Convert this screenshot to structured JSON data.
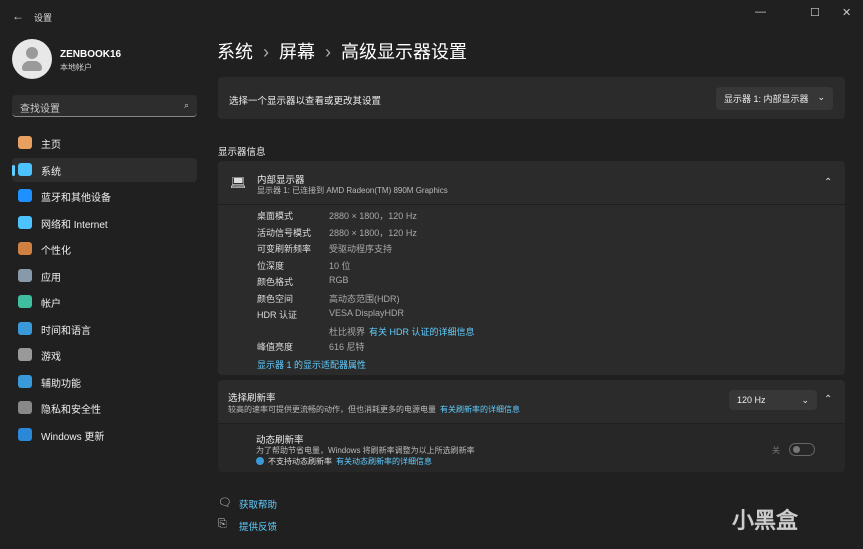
{
  "window": {
    "title": "设置",
    "back": "←",
    "minimize": "—",
    "maximize": "☐",
    "close": "✕"
  },
  "user": {
    "name": "ZENBOOK16",
    "type": "本地帐户"
  },
  "search": {
    "placeholder": "查找设置",
    "icon": "search-icon"
  },
  "sidebar": {
    "items": [
      {
        "label": "主页",
        "color": "#e8a060"
      },
      {
        "label": "系统",
        "color": "#4cc2ff"
      },
      {
        "label": "蓝牙和其他设备",
        "color": "#1e90ff"
      },
      {
        "label": "网络和 Internet",
        "color": "#4cc2ff"
      },
      {
        "label": "个性化",
        "color": "#d08040"
      },
      {
        "label": "应用",
        "color": "#8899aa"
      },
      {
        "label": "帐户",
        "color": "#3fbf9f"
      },
      {
        "label": "时间和语言",
        "color": "#3a9ad9"
      },
      {
        "label": "游戏",
        "color": "#999999"
      },
      {
        "label": "辅助功能",
        "color": "#3a9ad9"
      },
      {
        "label": "隐私和安全性",
        "color": "#888888"
      },
      {
        "label": "Windows 更新",
        "color": "#2b88d8"
      }
    ],
    "selected": 1
  },
  "breadcrumb": [
    "系统",
    "屏幕",
    "高级显示器设置"
  ],
  "select_display": {
    "label": "选择一个显示器以查看或更改其设置",
    "value": "显示器 1: 内部显示器"
  },
  "section_title": "显示器信息",
  "display": {
    "title": "内部显示器",
    "subtitle": "显示器 1: 已连接到 AMD Radeon(TM) 890M Graphics",
    "rows": [
      {
        "k": "桌面模式",
        "v": "2880 × 1800，120 Hz"
      },
      {
        "k": "活动信号模式",
        "v": "2880 × 1800，120 Hz"
      },
      {
        "k": "可变刷新频率",
        "v": "受驱动程序支持"
      },
      {
        "k": "位深度",
        "v": "10 位"
      },
      {
        "k": "颜色格式",
        "v": "RGB"
      },
      {
        "k": "颜色空间",
        "v": "高动态范围(HDR)"
      },
      {
        "k": "HDR 认证",
        "v": "VESA DisplayHDR"
      },
      {
        "k": "峰值亮度",
        "v": "616 尼特"
      }
    ],
    "hdr_extra": "杜比视界",
    "hdr_link": "有关 HDR 认证的详细信息",
    "adapter_link": "显示器 1 的显示适配器属性"
  },
  "refresh": {
    "title": "选择刷新率",
    "desc": "较高的速率可提供更流畅的动作，但也消耗更多的电源电量",
    "link": "有关刷新率的详细信息",
    "value": "120 Hz"
  },
  "dynamic": {
    "title": "动态刷新率",
    "desc": "为了帮助节省电量，Windows 将刷新率调整为以上所选刷新率",
    "note": "不支持动态刷新率",
    "link": "有关动态刷新率的详细信息",
    "state": "关"
  },
  "footer": {
    "help": "获取帮助",
    "feedback": "提供反馈"
  },
  "watermark": "小黑盒"
}
